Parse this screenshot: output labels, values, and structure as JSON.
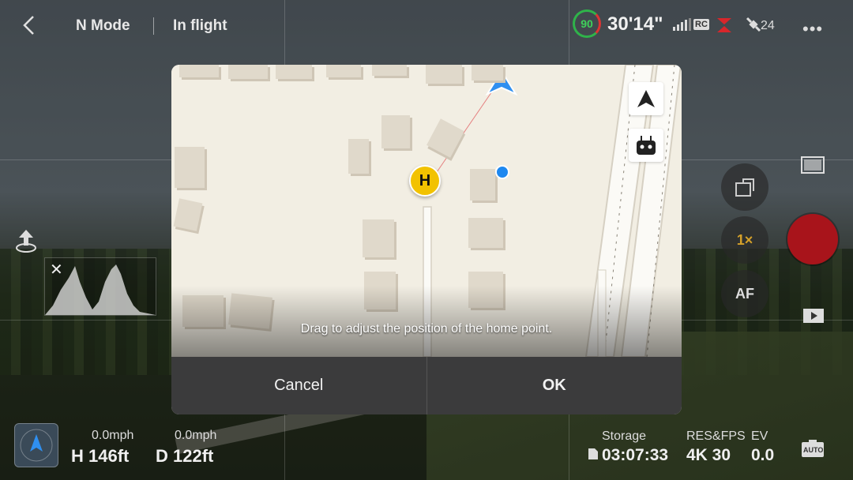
{
  "topbar": {
    "mode": "N Mode",
    "status": "In flight",
    "battery_percent": "90",
    "flight_time": "30'14\"",
    "rc_label": "RC",
    "satellites": "24"
  },
  "dialog": {
    "hint": "Drag to adjust the position of the home point.",
    "home_marker": "H",
    "cancel_label": "Cancel",
    "ok_label": "OK"
  },
  "camera": {
    "zoom": "1×",
    "af": "AF",
    "auto_label": "AUTO",
    "storage_label": "Storage",
    "storage_value": "03:07:33",
    "res_label": "RES&FPS",
    "res_value": "4K 30",
    "ev_label": "EV",
    "ev_value": "0.0"
  },
  "telemetry": {
    "vspeed": "0.0mph",
    "hspeed": "0.0mph",
    "height": "H 146ft",
    "distance": "D 122ft"
  },
  "colors": {
    "battery_green": "#2fb34a",
    "shutter_red": "#a8141b",
    "home_yellow": "#f2c200",
    "aircraft_blue": "#2f8ff0"
  }
}
